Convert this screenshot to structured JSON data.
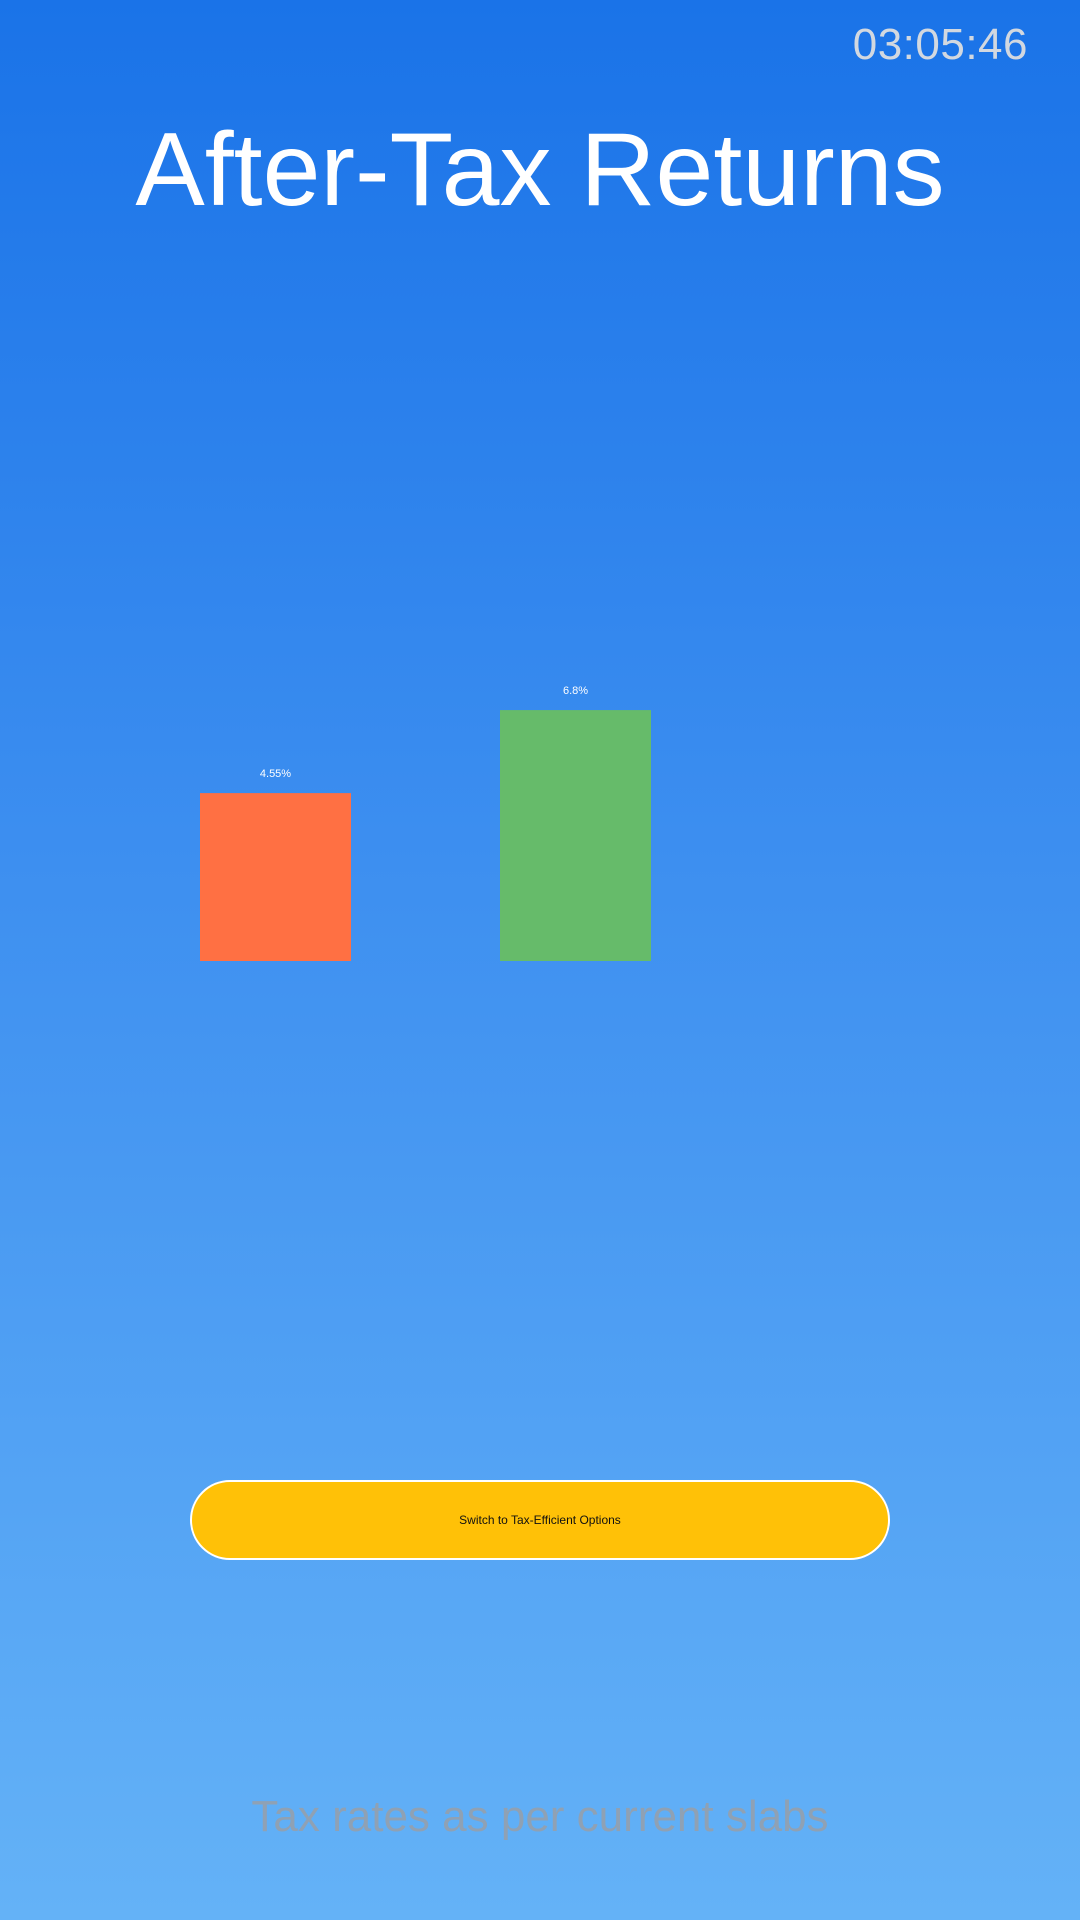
{
  "header": {
    "clock": "03:05:46",
    "title": "After-Tax Returns"
  },
  "chart_data": {
    "type": "bar",
    "categories": [
      "",
      ""
    ],
    "values": [
      4.55,
      6.8
    ],
    "value_labels": [
      "4.55%",
      "6.8%"
    ],
    "colors": [
      "#ff7043",
      "#66bb6a"
    ],
    "title": "",
    "xlabel": "",
    "ylabel": "",
    "grid": false
  },
  "cta": {
    "label": "Switch to Tax-Efficient Options"
  },
  "footer": {
    "note": "Tax rates as per current slabs"
  }
}
